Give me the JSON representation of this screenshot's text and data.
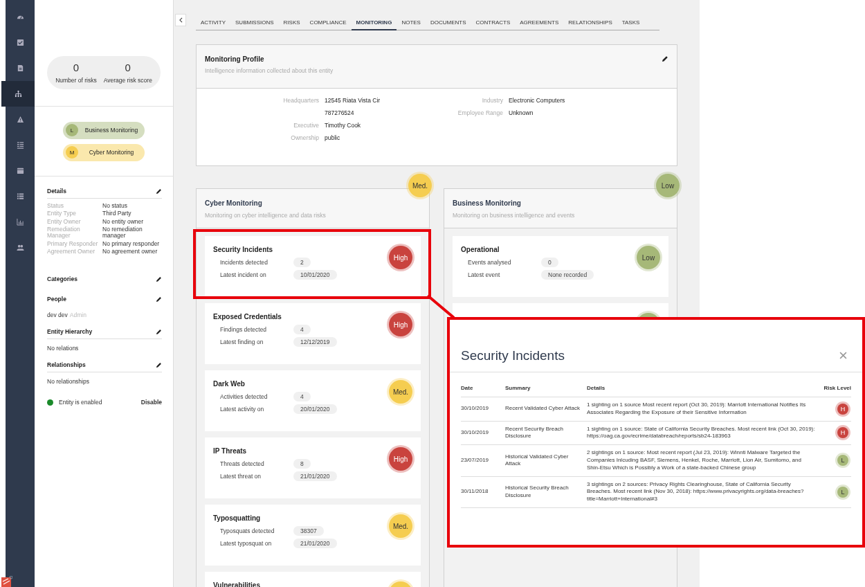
{
  "nav": [
    {
      "kind": "gauge",
      "selected": false
    },
    {
      "kind": "check",
      "selected": false
    },
    {
      "kind": "document",
      "selected": false
    },
    {
      "kind": "hierarchy",
      "selected": true
    },
    {
      "kind": "warning",
      "selected": false
    },
    {
      "kind": "tasks",
      "selected": false
    },
    {
      "kind": "calendar",
      "selected": false
    },
    {
      "kind": "list",
      "selected": false
    },
    {
      "kind": "chart",
      "selected": false
    },
    {
      "kind": "people",
      "selected": false
    }
  ],
  "summary": [
    {
      "value": "0",
      "label": "Number of risks"
    },
    {
      "value": "0",
      "label": "Average risk score"
    }
  ],
  "monitors": [
    {
      "letter": "L",
      "label": "Business Monitoring",
      "color": "#a6b878"
    },
    {
      "letter": "M",
      "label": "Cyber Monitoring",
      "color": "#f5cd50"
    }
  ],
  "details": {
    "title": "Details",
    "rows": [
      {
        "label": "Status",
        "value": "No status"
      },
      {
        "label": "Entity Type",
        "value": "Third Party"
      },
      {
        "label": "Entity Owner",
        "value": "No entity owner"
      },
      {
        "label": "Remediation Manager",
        "value": "No remediation manager"
      },
      {
        "label": "Primary Responder",
        "value": "No primary responder"
      },
      {
        "label": "Agreement Owner",
        "value": "No agreement owner"
      }
    ]
  },
  "sections": [
    {
      "title": "Categories",
      "divider": false
    },
    {
      "title": "People",
      "divider": false,
      "content": "dev dev",
      "note": "Admin"
    },
    {
      "title": "Entity Hierarchy",
      "divider": true,
      "content": "No relations"
    },
    {
      "title": "Relationships",
      "divider": true,
      "content": "No relationships"
    }
  ],
  "entity_status": {
    "enabled": true,
    "label": "Entity is enabled",
    "action": "Disable"
  },
  "tabs": [
    {
      "label": "ACTIVITY",
      "selected": false
    },
    {
      "label": "SUBMISSIONS",
      "selected": false
    },
    {
      "label": "RISKS",
      "selected": false
    },
    {
      "label": "COMPLIANCE",
      "selected": false
    },
    {
      "label": "MONITORING",
      "selected": true
    },
    {
      "label": "NOTES",
      "selected": false
    },
    {
      "label": "DOCUMENTS",
      "selected": false
    },
    {
      "label": "CONTRACTS",
      "selected": false
    },
    {
      "label": "AGREEMENTS",
      "selected": false
    },
    {
      "label": "RELATIONSHIPS",
      "selected": false
    },
    {
      "label": "TASKS",
      "selected": false
    }
  ],
  "profile": {
    "title": "Monitoring Profile",
    "subtitle": "Intelligence information collected about this entity",
    "left": [
      {
        "label": "Headquarters",
        "value": "12545 Riata Vista Cir"
      },
      {
        "value": "787276524"
      },
      {
        "label": "Executive",
        "value": "Timothy Cook"
      },
      {
        "label": "Ownership",
        "value": "public"
      }
    ],
    "right": [
      {
        "label": "Industry",
        "value": "Electronic Computers"
      },
      {
        "label": "Employee Range",
        "value": "Unknown"
      }
    ]
  },
  "columns": [
    {
      "title": "Cyber Monitoring",
      "subtitle": "Monitoring on cyber intelligence and data risks",
      "color": "#f5cd50",
      "badge": "Med.",
      "cards": [
        {
          "title": "Security Incidents",
          "color": "#c9433e",
          "badge": "High",
          "rows": [
            {
              "label": "Incidents detected",
              "value": "2"
            },
            {
              "label": "Latest incident on",
              "value": "10/01/2020"
            }
          ]
        },
        {
          "title": "Exposed Credentials",
          "color": "#c9433e",
          "badge": "High",
          "rows": [
            {
              "label": "Findings detected",
              "value": "4"
            },
            {
              "label": "Latest finding on",
              "value": "12/12/2019"
            }
          ]
        },
        {
          "title": "Dark Web",
          "color": "#f5cd50",
          "badge": "Med.",
          "rows": [
            {
              "label": "Activities detected",
              "value": "4"
            },
            {
              "label": "Latest activity on",
              "value": "20/01/2020"
            }
          ]
        },
        {
          "title": "IP Threats",
          "color": "#c9433e",
          "badge": "High",
          "rows": [
            {
              "label": "Threats detected",
              "value": "8"
            },
            {
              "label": "Latest threat on",
              "value": "21/01/2020"
            }
          ]
        },
        {
          "title": "Typosquatting",
          "color": "#f5cd50",
          "badge": "Med.",
          "rows": [
            {
              "label": "Typosquats detected",
              "value": "38307"
            },
            {
              "label": "Latest typosquat on",
              "value": "21/01/2020"
            }
          ]
        },
        {
          "title": "Vulnerabilities",
          "color": "#f5cd50"
        }
      ]
    },
    {
      "title": "Business Monitoring",
      "subtitle": "Monitoring on business intelligence and events",
      "color": "#a6b878",
      "badge": "Low",
      "cards": [
        {
          "title": "Operational",
          "color": "#a6b878",
          "badge": "Low",
          "rows": [
            {
              "label": "Events analysed",
              "value": "0"
            },
            {
              "label": "Latest event",
              "value": "None recorded"
            }
          ]
        },
        {
          "color": "#a6b878"
        }
      ]
    }
  ],
  "popup": {
    "title": "Security Incidents",
    "columns": [
      "Date",
      "Summary",
      "Details",
      "Risk Level"
    ],
    "rows": [
      {
        "date": "30/10/2019",
        "summary": "Recent Validated Cyber Attack",
        "details": "1 sighting on 1 source Most recent report (Oct 30, 2019): Marriott International Notifies Its Associates Regarding the Exposure of their Sensitive Information",
        "color": "#c9433e",
        "badge": "H"
      },
      {
        "date": "30/10/2019",
        "summary": "Recent Security Breach Disclosure",
        "details": "1 sighting on 1 source: State of California Security Breaches. Most recent link (Oct 30, 2019): https://oag.ca.gov/ecrime/databreach/reports/sb24-183963",
        "color": "#c9433e",
        "badge": "H"
      },
      {
        "date": "23/07/2019",
        "summary": "Historical Validated Cyber Attack",
        "details": "2 sightings on 1 source: Most recent report (Jul 23, 2019): Winnti Malware Targeted the Companies Inlcuding BASF, Siemens, Henkel, Roche, Marriott, Lion Air, Sumitomo, and Shin-Etsu Which is Possibly a Work of a state-backed Chinese group",
        "color": "#a6b878",
        "badge": "L"
      },
      {
        "date": "30/11/2018",
        "summary": "Historical Security Breach Disclosure",
        "details": "3 sightings on 2 sources: Privacy Rights Clearinghouse, State of California Security Breaches. Most recent link (Nov 30, 2018): https://www.privacyrights.org/data-breaches?title=Marriott+International#3",
        "color": "#a6b878",
        "badge": "L"
      }
    ]
  }
}
